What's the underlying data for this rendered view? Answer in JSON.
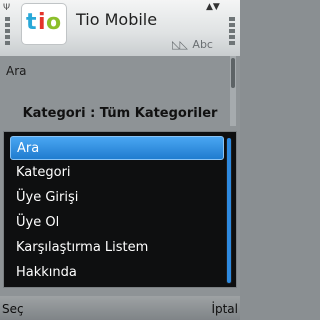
{
  "titlebar": {
    "app_title": "Tio Mobile",
    "logo_letters": [
      "t",
      "i",
      "o"
    ],
    "indicator_text": "Abc",
    "indicator_icon": "keyboard-triangles"
  },
  "content": {
    "search_label": "Ara",
    "category_header": "Kategori : Tüm Kategoriler"
  },
  "menu": {
    "items": [
      {
        "label": "Ara",
        "selected": true
      },
      {
        "label": "Kategori",
        "selected": false
      },
      {
        "label": "Üye Girişi",
        "selected": false
      },
      {
        "label": "Üye Ol",
        "selected": false
      },
      {
        "label": "Karşılaştırma Listem",
        "selected": false
      },
      {
        "label": "Hakkında",
        "selected": false
      }
    ]
  },
  "softkeys": {
    "left": "Seç",
    "right": "İptal"
  },
  "colors": {
    "selection": "#2a8ae0",
    "menu_bg": "#0e0f10",
    "logo_t": "#29a8d8",
    "logo_i": "#e4332a",
    "logo_o": "#8cbf2b"
  }
}
